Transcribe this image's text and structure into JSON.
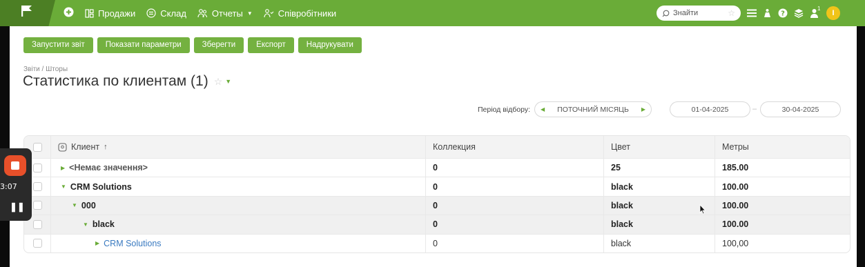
{
  "topbar": {
    "nav": [
      {
        "label": "Продажи",
        "icon": "grid-icon"
      },
      {
        "label": "Склад",
        "icon": "box-icon"
      },
      {
        "label": "Отчеты",
        "icon": "users-icon",
        "dropdown": true
      },
      {
        "label": "Співробітники",
        "icon": "people-icon"
      }
    ],
    "search_placeholder": "Знайти",
    "avatar_letter": "I",
    "notification_count": "1",
    "accent": "#6aac38"
  },
  "actions": [
    "Запустити звіт",
    "Показати параметри",
    "Зберегти",
    "Експорт",
    "Надрукувати"
  ],
  "breadcrumb": "Звіти / Шторы",
  "page_title": "Статистика по клиентам (1)",
  "period": {
    "label": "Період відбору:",
    "value": "ПОТОЧНИЙ МІСЯЦЬ",
    "from": "01-04-2025",
    "separator": "–",
    "to": "30-04-2025"
  },
  "table": {
    "columns": [
      "Клиент",
      "Коллекция",
      "Цвет",
      "Метры"
    ],
    "sort_indicator": "↑",
    "rows": [
      {
        "client": "<Немає значення>",
        "collection": "0",
        "color": "25",
        "meters": "185.00",
        "level": 0,
        "expanded": false,
        "bold": true,
        "muted": true
      },
      {
        "client": "CRM Solutions",
        "collection": "0",
        "color": "black",
        "meters": "100.00",
        "level": 0,
        "expanded": true,
        "bold": true
      },
      {
        "client": "000",
        "collection": "0",
        "color": "black",
        "meters": "100.00",
        "level": 1,
        "expanded": true,
        "bold": true
      },
      {
        "client": "black",
        "collection": "0",
        "color": "black",
        "meters": "100.00",
        "level": 2,
        "expanded": true,
        "bold": true
      },
      {
        "client": "CRM Solutions",
        "collection": "0",
        "color": "black",
        "meters": "100,00",
        "level": 3,
        "expanded": false,
        "bold": false,
        "link": true
      }
    ]
  },
  "recorder": {
    "time": "3:07"
  }
}
